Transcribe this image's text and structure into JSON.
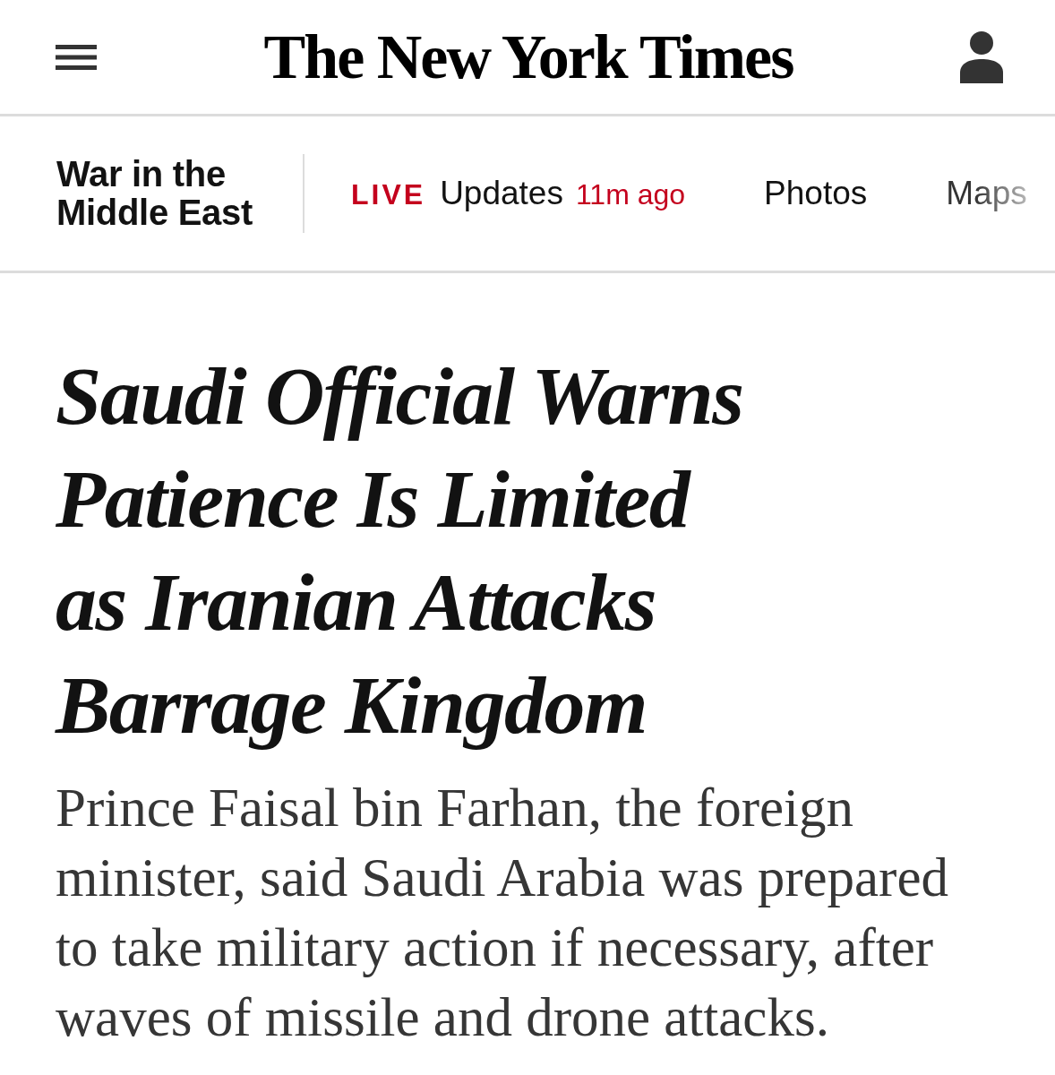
{
  "header": {
    "logo": "The New York Times"
  },
  "section_nav": {
    "title": "War in the Middle East",
    "links": [
      {
        "kind": "live",
        "badge": "LIVE",
        "label": "Updates",
        "time": "11m ago"
      },
      {
        "kind": "plain",
        "label": "Photos"
      },
      {
        "kind": "plain",
        "label": "Maps"
      }
    ]
  },
  "article": {
    "headline": "Saudi Official Warns Patience Is Limited as Iranian Attacks Barrage Kingdom",
    "summary": "Prince Faisal bin Farhan, the foreign minister, said Saudi Arabia was prepared to take military action if necessary, after waves of missile and drone attacks."
  }
}
